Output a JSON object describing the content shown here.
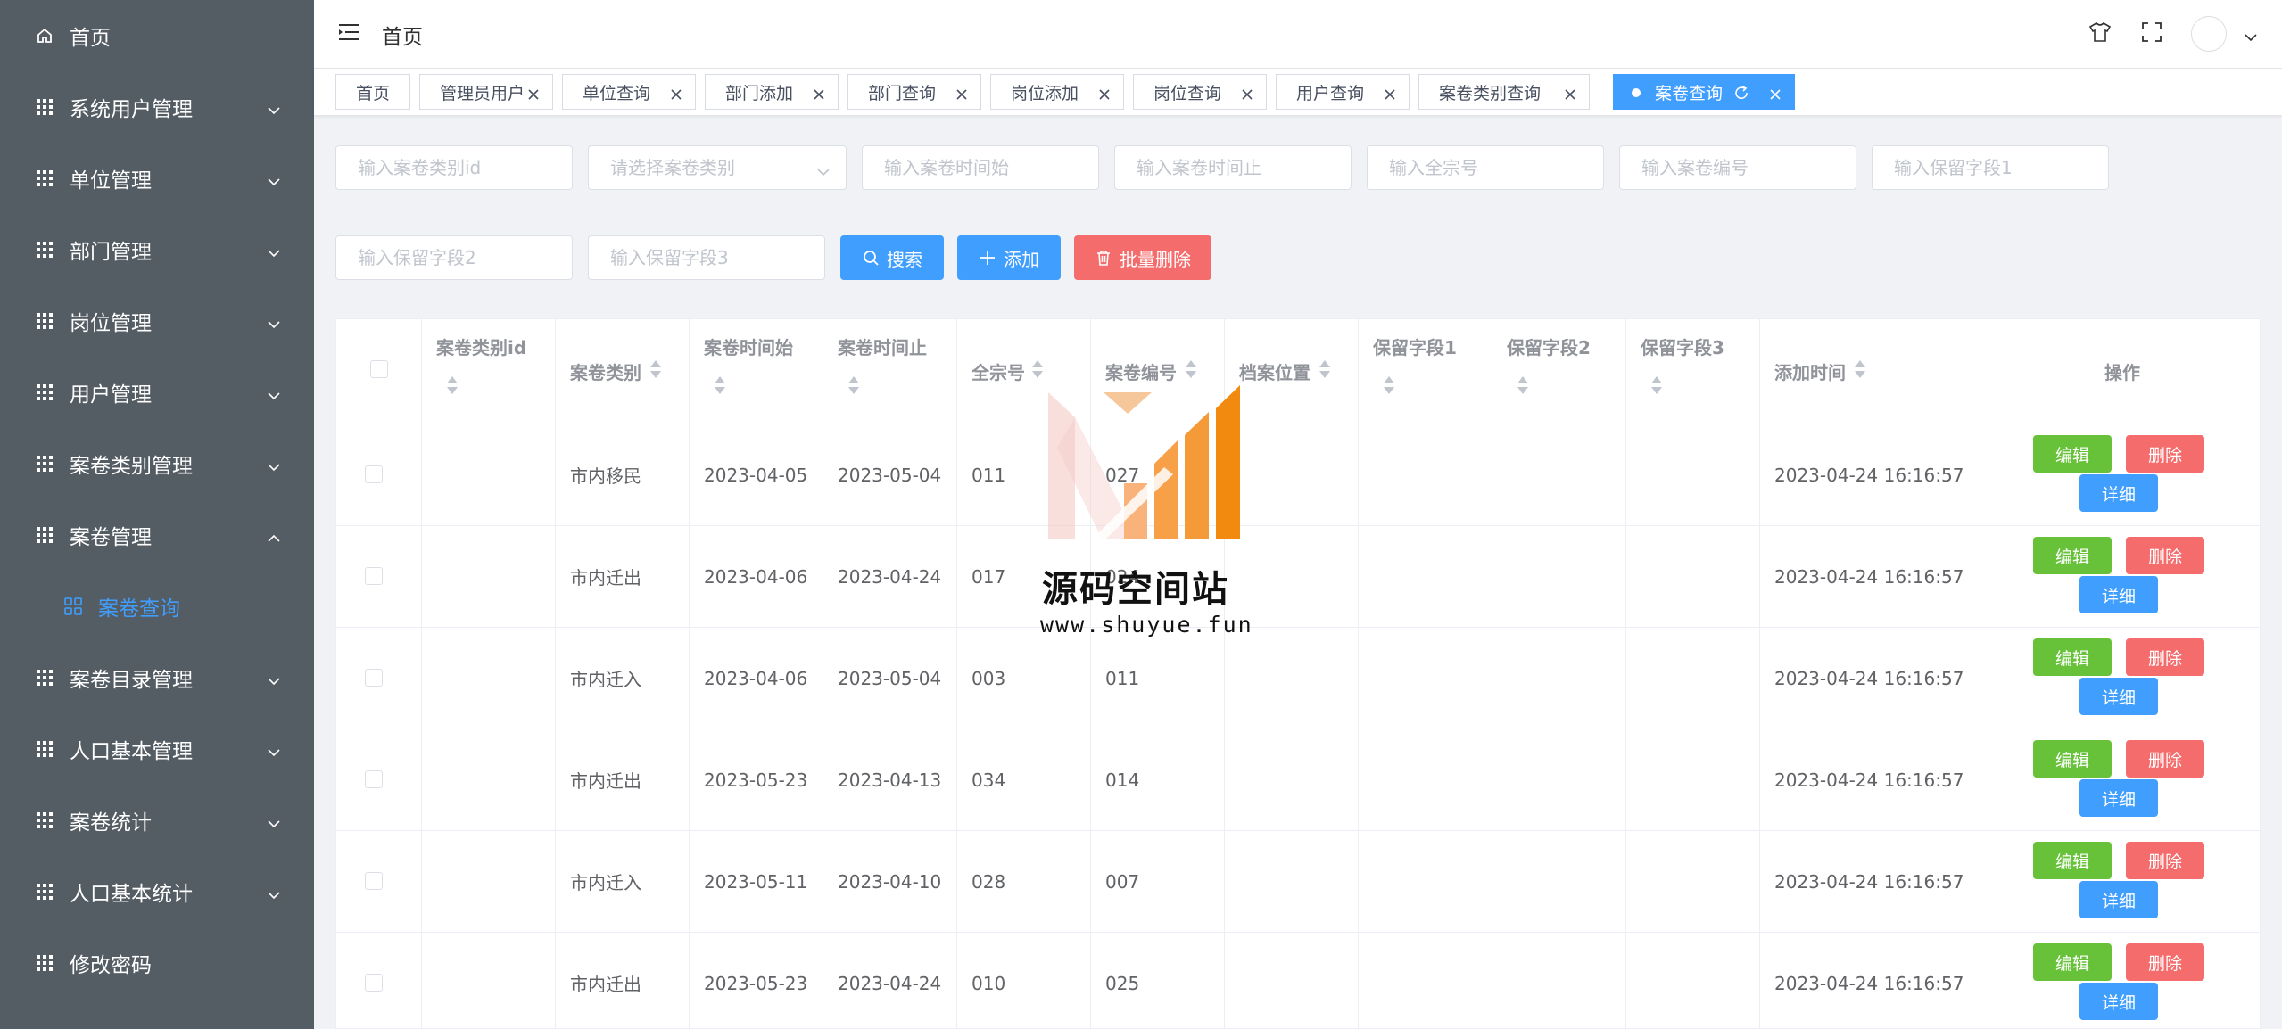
{
  "sidebar": {
    "items": [
      {
        "label": "首页",
        "icon": "home-icon"
      },
      {
        "label": "系统用户管理",
        "icon": "grid-icon"
      },
      {
        "label": "单位管理",
        "icon": "grid-icon"
      },
      {
        "label": "部门管理",
        "icon": "grid-icon"
      },
      {
        "label": "岗位管理",
        "icon": "grid-icon"
      },
      {
        "label": "用户管理",
        "icon": "grid-icon"
      },
      {
        "label": "案卷类别管理",
        "icon": "grid-icon"
      },
      {
        "label": "案卷管理",
        "icon": "grid-icon",
        "expanded": true
      },
      {
        "label": "案卷目录管理",
        "icon": "grid-icon"
      },
      {
        "label": "人口基本管理",
        "icon": "grid-icon"
      },
      {
        "label": "案卷统计",
        "icon": "grid-icon"
      },
      {
        "label": "人口基本统计",
        "icon": "grid-icon"
      },
      {
        "label": "修改密码",
        "icon": "grid-icon"
      }
    ],
    "submenu": {
      "label": "案卷查询",
      "icon": "menu-grid-icon"
    }
  },
  "header": {
    "breadcrumb": "首页",
    "icons": [
      "tshirt-icon",
      "fullscreen-icon",
      "avatar",
      "chevron-down-icon"
    ]
  },
  "tags": [
    {
      "label": "首页",
      "closable": false
    },
    {
      "label": "管理员用户",
      "closable": true
    },
    {
      "label": "单位查询",
      "closable": true
    },
    {
      "label": "部门添加",
      "closable": true
    },
    {
      "label": "部门查询",
      "closable": true
    },
    {
      "label": "岗位添加",
      "closable": true
    },
    {
      "label": "岗位查询",
      "closable": true
    },
    {
      "label": "用户查询",
      "closable": true
    },
    {
      "label": "案卷类别查询",
      "closable": true
    },
    {
      "label": "案卷查询",
      "closable": true,
      "active": true
    }
  ],
  "search": {
    "placeholders": [
      "输入案卷类别id",
      "请选择案卷类别",
      "输入案卷时间始",
      "输入案卷时间止",
      "输入全宗号",
      "输入案卷编号",
      "输入保留字段1",
      "输入保留字段2",
      "输入保留字段3"
    ],
    "search_label": "搜索",
    "add_label": "添加",
    "batch_delete_label": "批量删除"
  },
  "table": {
    "columns": [
      "案卷类别id",
      "案卷类别",
      "案卷时间始",
      "案卷时间止",
      "全宗号",
      "案卷编号",
      "档案位置",
      "保留字段1",
      "保留字段2",
      "保留字段3",
      "添加时间",
      "操作"
    ],
    "rows": [
      {
        "category_id": "",
        "category": "市内移民",
        "start": "2023-04-05",
        "end": "2023-05-04",
        "fonds": "011",
        "number": "027",
        "location": "",
        "r1": "",
        "r2": "",
        "r3": "",
        "added": "2023-04-24 16:16:57"
      },
      {
        "category_id": "",
        "category": "市内迁出",
        "start": "2023-04-06",
        "end": "2023-04-24",
        "fonds": "017",
        "number": "024",
        "location": "",
        "r1": "",
        "r2": "",
        "r3": "",
        "added": "2023-04-24 16:16:57"
      },
      {
        "category_id": "",
        "category": "市内迁入",
        "start": "2023-04-06",
        "end": "2023-05-04",
        "fonds": "003",
        "number": "011",
        "location": "",
        "r1": "",
        "r2": "",
        "r3": "",
        "added": "2023-04-24 16:16:57"
      },
      {
        "category_id": "",
        "category": "市内迁出",
        "start": "2023-05-23",
        "end": "2023-04-13",
        "fonds": "034",
        "number": "014",
        "location": "",
        "r1": "",
        "r2": "",
        "r3": "",
        "added": "2023-04-24 16:16:57"
      },
      {
        "category_id": "",
        "category": "市内迁入",
        "start": "2023-05-11",
        "end": "2023-04-10",
        "fonds": "028",
        "number": "007",
        "location": "",
        "r1": "",
        "r2": "",
        "r3": "",
        "added": "2023-04-24 16:16:57"
      },
      {
        "category_id": "",
        "category": "市内迁出",
        "start": "2023-05-23",
        "end": "2023-04-24",
        "fonds": "010",
        "number": "025",
        "location": "",
        "r1": "",
        "r2": "",
        "r3": "",
        "added": "2023-04-24 16:16:57"
      }
    ],
    "actions": {
      "edit": "编辑",
      "delete": "删除",
      "detail": "详细"
    }
  },
  "watermark": {
    "title": "源码空间站",
    "url": "www.shuyue.fun"
  },
  "colors": {
    "sidebar_bg": "#545c64",
    "primary": "#409eff",
    "success": "#67c23a",
    "danger": "#f56c6c"
  }
}
